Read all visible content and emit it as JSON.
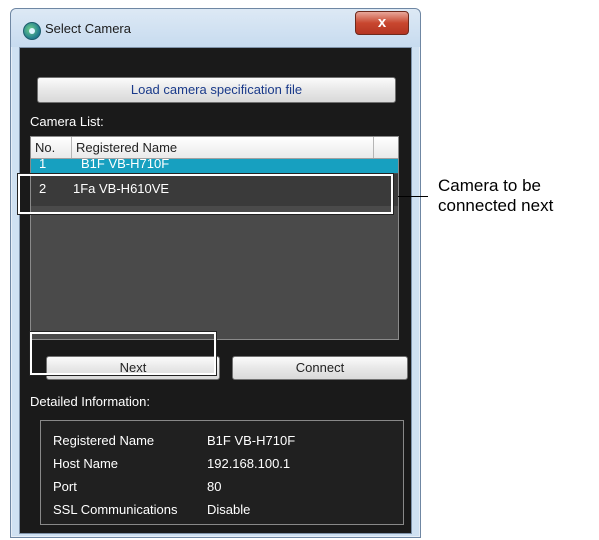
{
  "window": {
    "title": "Select Camera",
    "close_glyph": "x"
  },
  "toolbar": {
    "load_label": "Load camera specification file"
  },
  "camera_list": {
    "label": "Camera List:",
    "headers": [
      "No.",
      "Registered Name"
    ],
    "rows": [
      {
        "no": "1",
        "name": "B1F VB-H710F"
      },
      {
        "no": "2",
        "name": "1Fa VB-H610VE"
      }
    ]
  },
  "buttons": {
    "next_label": "Next",
    "connect_label": "Connect"
  },
  "details": {
    "label": "Detailed Information:",
    "rows": [
      {
        "key": "Registered Name",
        "value": "B1F VB-H710F"
      },
      {
        "key": "Host Name",
        "value": "192.168.100.1"
      },
      {
        "key": "Port",
        "value": "80"
      },
      {
        "key": "SSL Communications",
        "value": "Disable"
      }
    ]
  },
  "callout": {
    "line1": "Camera to be",
    "line2": "connected next"
  },
  "colors": {
    "selection": "#17a0c0",
    "client_bg": "#1a1a1a"
  }
}
